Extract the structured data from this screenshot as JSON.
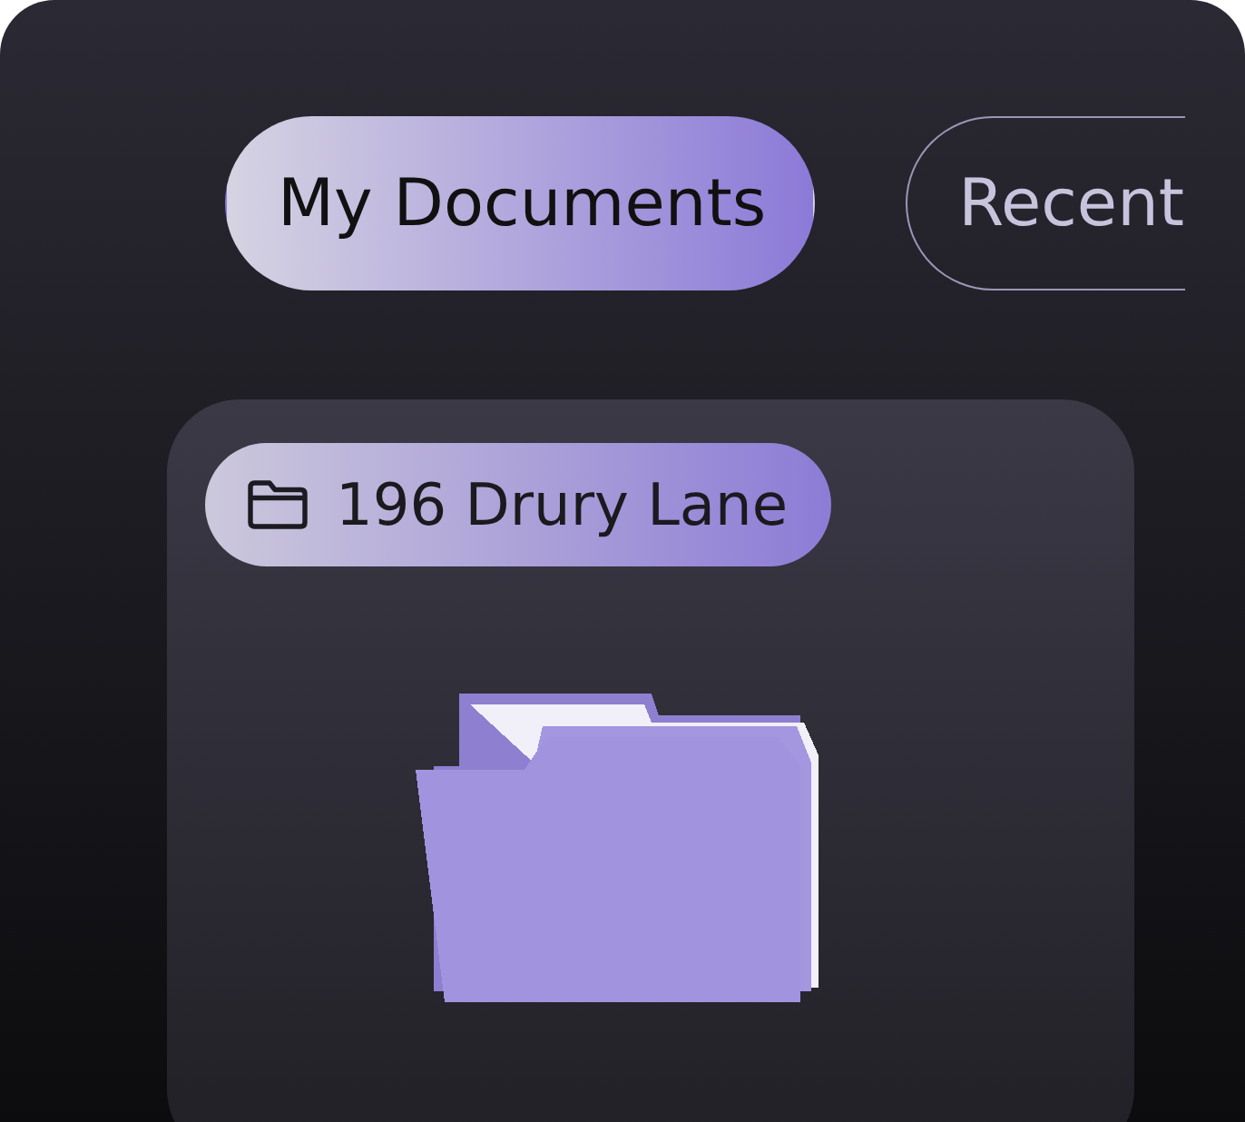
{
  "tabs": [
    {
      "label": "My Documents",
      "selected": true
    },
    {
      "label": "Recent",
      "selected": false
    }
  ],
  "folder": {
    "name": "196 Drury Lane"
  }
}
